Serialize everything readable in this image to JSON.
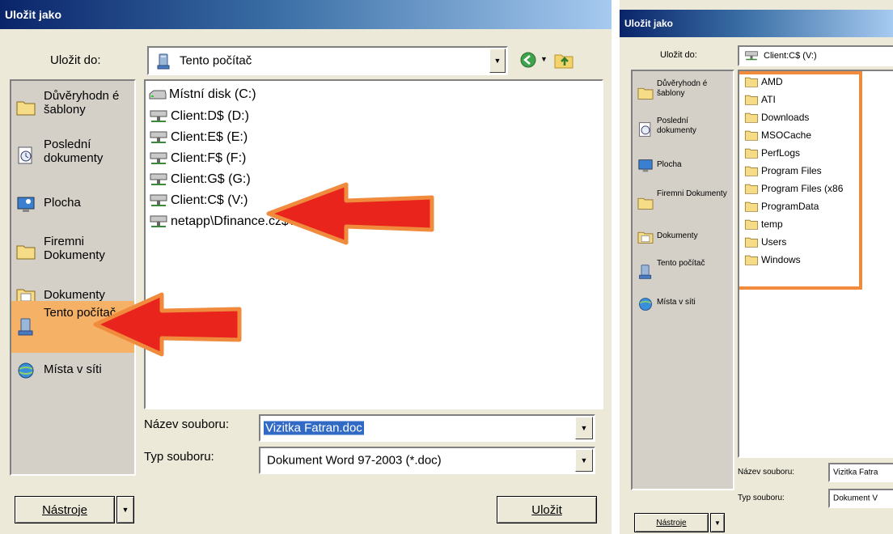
{
  "left_dialog": {
    "title": "Uložit jako",
    "save_in_label": "Uložit do:",
    "save_in_value": "Tento počítač",
    "places": [
      {
        "label": "Důvěryhodn é šablony",
        "icon": "folder-icon"
      },
      {
        "label": "Poslední dokumenty",
        "icon": "recent-documents-icon"
      },
      {
        "label": "Plocha",
        "icon": "desktop-icon"
      },
      {
        "label": "Firemni Dokumenty",
        "icon": "folder-icon"
      },
      {
        "label": "Dokumenty",
        "icon": "documents-icon"
      },
      {
        "label": "Tento počítač",
        "icon": "computer-icon",
        "selected": true
      },
      {
        "label": "Místa v síti",
        "icon": "network-icon"
      }
    ],
    "drives": [
      {
        "label": "Místní disk (C:)",
        "icon": "local-disk-icon"
      },
      {
        "label": "Client:D$ (D:)",
        "icon": "network-drive-icon"
      },
      {
        "label": "Client:E$ (E:)",
        "icon": "network-drive-icon"
      },
      {
        "label": "Client:F$ (F:)",
        "icon": "network-drive-icon"
      },
      {
        "label": "Client:G$ (G:)",
        "icon": "network-drive-icon"
      },
      {
        "label": "Client:C$ (V:)",
        "icon": "network-drive-icon"
      },
      {
        "label": "netapp\\Dfinance.cz$\\Users:pavlusek.mar",
        "icon": "network-drive-icon"
      }
    ],
    "filename_label": "Název souboru:",
    "filename_value": "Vizitka Fatran.doc",
    "filetype_label": "Typ souboru:",
    "filetype_value": "Dokument Word 97-2003 (*.doc)",
    "tools_label": "Nástroje",
    "save_label": "Uložit"
  },
  "right_dialog": {
    "title": "Uložit jako",
    "save_in_label": "Uložit do:",
    "save_in_value": "Client:C$ (V:)",
    "places": [
      {
        "label": "Důvěryhodn é šablony",
        "icon": "folder-icon"
      },
      {
        "label": "Poslední dokumenty",
        "icon": "recent-documents-icon"
      },
      {
        "label": "Plocha",
        "icon": "desktop-icon"
      },
      {
        "label": "Firemni Dokumenty",
        "icon": "folder-icon"
      },
      {
        "label": "Dokumenty",
        "icon": "documents-icon"
      },
      {
        "label": "Tento počítač",
        "icon": "computer-icon"
      },
      {
        "label": "Místa v síti",
        "icon": "network-icon"
      }
    ],
    "folders": [
      "AMD",
      "ATI",
      "Downloads",
      "MSOCache",
      "PerfLogs",
      "Program Files",
      "Program Files (x86",
      "ProgramData",
      "temp",
      "Users",
      "Windows"
    ],
    "filename_label": "Název souboru:",
    "filename_value": "Vizitka Fatra",
    "filetype_label": "Typ souboru:",
    "filetype_value": "Dokument V",
    "tools_label": "Nástroje"
  },
  "colors": {
    "annotation_arrow": "#e8241c",
    "annotation_outline": "#f08a3c",
    "selected_place": "#f5b266",
    "titlebar": "#0a246a"
  }
}
